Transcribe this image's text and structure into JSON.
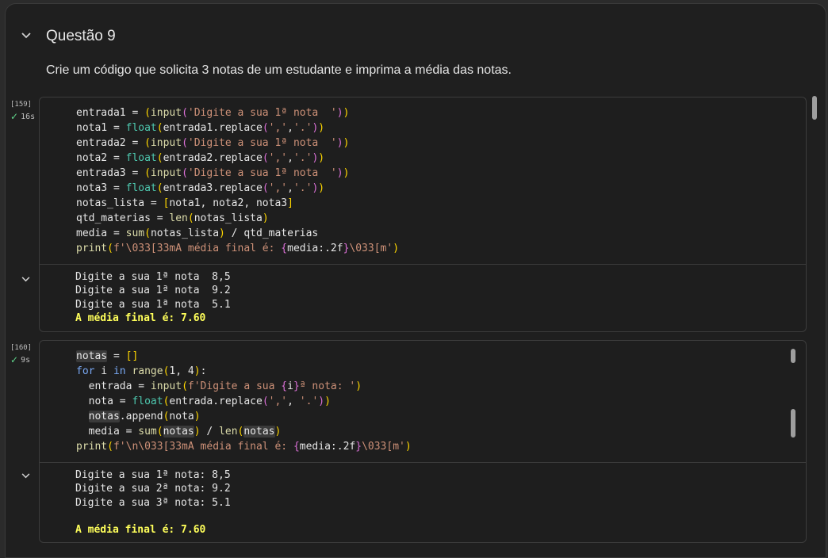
{
  "section": {
    "title": "Questão 9",
    "description": "Crie um código que solicita 3 notas de um estudante e imprima a média das notas."
  },
  "cells": [
    {
      "exec_count": "[159]",
      "duration": "16s",
      "output_lines": [
        "Digite a sua 1ª nota  8,5",
        "Digite a sua 1ª nota  9.2",
        "Digite a sua 1ª nota  5.1"
      ],
      "output_result": "A média final é: 7.60"
    },
    {
      "exec_count": "[160]",
      "duration": "9s",
      "output_lines": [
        "Digite a sua 1ª nota: 8,5",
        "Digite a sua 2ª nota: 9.2",
        "Digite a sua 3ª nota: 5.1",
        ""
      ],
      "output_result": "A média final é: 7.60"
    }
  ],
  "code": {
    "c1_input": "input",
    "c1_prompt": "'Digite a sua 1ª nota  '",
    "c1_float": "float",
    "c1_replace": ".replace(",
    "c1_args": "','",
    "c1_args2": "'.'",
    "c1_list": "notas_lista = ",
    "c1_len": "len",
    "c1_sum": "sum",
    "c1_print": "print",
    "c1_fstring": "f'\\033[33mA média final é: ",
    "c1_fexpr": "media:.2f",
    "c1_fend": "\\033[m'",
    "c2_notas": "notas",
    "c2_for": "for",
    "c2_in": "in",
    "c2_range": "range",
    "c2_prompt_a": "f'Digite a sua ",
    "c2_prompt_b": "i",
    "c2_prompt_c": "ª nota: '",
    "c2_fstring": "f'\\n\\033[33mA média final é: "
  },
  "icons": {
    "collapse": "chevron-down-icon",
    "success": "check-icon"
  }
}
